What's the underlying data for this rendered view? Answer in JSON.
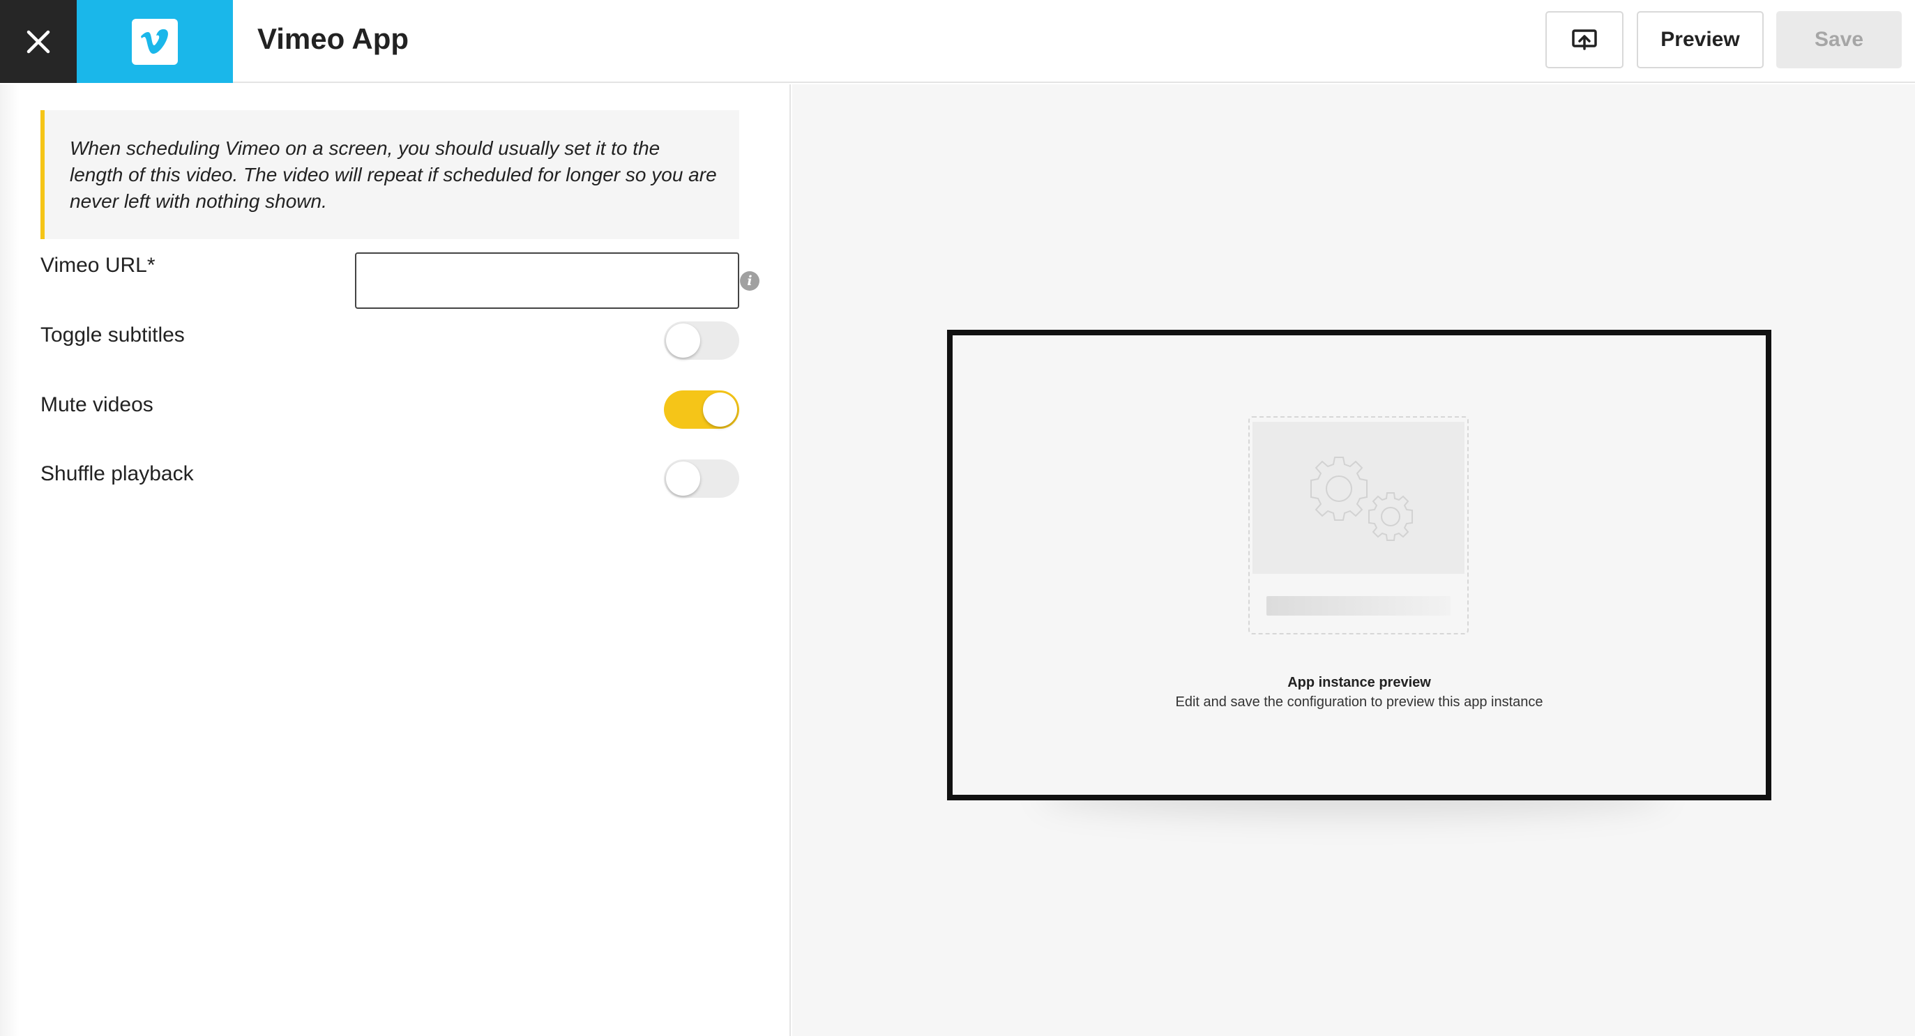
{
  "header": {
    "title": "Vimeo App",
    "close_icon": "close-icon",
    "logo_icon": "vimeo-logo",
    "cast_icon": "cast-screen-icon",
    "preview_label": "Preview",
    "save_label": "Save"
  },
  "config": {
    "notice": "When scheduling Vimeo on a screen, you should usually set it to the length of this video. The video will repeat if scheduled for longer so you are never left with nothing shown.",
    "url_label": "Vimeo URL*",
    "url_value": "",
    "url_info_icon": "info-icon",
    "toggles": [
      {
        "label": "Toggle subtitles",
        "on": false
      },
      {
        "label": "Mute videos",
        "on": true
      },
      {
        "label": "Shuffle playback",
        "on": false
      }
    ]
  },
  "preview": {
    "title": "App instance preview",
    "subtitle": "Edit and save the configuration to preview this app instance",
    "placeholder_icon": "gears-icon"
  },
  "colors": {
    "brand": "#1ab7ea",
    "accent": "#f5c518",
    "dark": "#262626"
  }
}
